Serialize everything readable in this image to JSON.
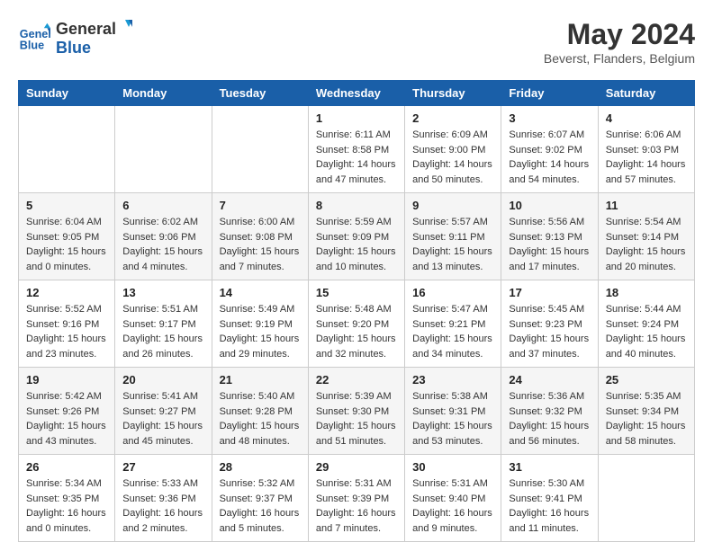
{
  "logo": {
    "line1": "General",
    "line2": "Blue"
  },
  "title": "May 2024",
  "location": "Beverst, Flanders, Belgium",
  "weekdays": [
    "Sunday",
    "Monday",
    "Tuesday",
    "Wednesday",
    "Thursday",
    "Friday",
    "Saturday"
  ],
  "weeks": [
    [
      {
        "day": "",
        "sunrise": "",
        "sunset": "",
        "daylight": ""
      },
      {
        "day": "",
        "sunrise": "",
        "sunset": "",
        "daylight": ""
      },
      {
        "day": "",
        "sunrise": "",
        "sunset": "",
        "daylight": ""
      },
      {
        "day": "1",
        "sunrise": "Sunrise: 6:11 AM",
        "sunset": "Sunset: 8:58 PM",
        "daylight": "Daylight: 14 hours and 47 minutes."
      },
      {
        "day": "2",
        "sunrise": "Sunrise: 6:09 AM",
        "sunset": "Sunset: 9:00 PM",
        "daylight": "Daylight: 14 hours and 50 minutes."
      },
      {
        "day": "3",
        "sunrise": "Sunrise: 6:07 AM",
        "sunset": "Sunset: 9:02 PM",
        "daylight": "Daylight: 14 hours and 54 minutes."
      },
      {
        "day": "4",
        "sunrise": "Sunrise: 6:06 AM",
        "sunset": "Sunset: 9:03 PM",
        "daylight": "Daylight: 14 hours and 57 minutes."
      }
    ],
    [
      {
        "day": "5",
        "sunrise": "Sunrise: 6:04 AM",
        "sunset": "Sunset: 9:05 PM",
        "daylight": "Daylight: 15 hours and 0 minutes."
      },
      {
        "day": "6",
        "sunrise": "Sunrise: 6:02 AM",
        "sunset": "Sunset: 9:06 PM",
        "daylight": "Daylight: 15 hours and 4 minutes."
      },
      {
        "day": "7",
        "sunrise": "Sunrise: 6:00 AM",
        "sunset": "Sunset: 9:08 PM",
        "daylight": "Daylight: 15 hours and 7 minutes."
      },
      {
        "day": "8",
        "sunrise": "Sunrise: 5:59 AM",
        "sunset": "Sunset: 9:09 PM",
        "daylight": "Daylight: 15 hours and 10 minutes."
      },
      {
        "day": "9",
        "sunrise": "Sunrise: 5:57 AM",
        "sunset": "Sunset: 9:11 PM",
        "daylight": "Daylight: 15 hours and 13 minutes."
      },
      {
        "day": "10",
        "sunrise": "Sunrise: 5:56 AM",
        "sunset": "Sunset: 9:13 PM",
        "daylight": "Daylight: 15 hours and 17 minutes."
      },
      {
        "day": "11",
        "sunrise": "Sunrise: 5:54 AM",
        "sunset": "Sunset: 9:14 PM",
        "daylight": "Daylight: 15 hours and 20 minutes."
      }
    ],
    [
      {
        "day": "12",
        "sunrise": "Sunrise: 5:52 AM",
        "sunset": "Sunset: 9:16 PM",
        "daylight": "Daylight: 15 hours and 23 minutes."
      },
      {
        "day": "13",
        "sunrise": "Sunrise: 5:51 AM",
        "sunset": "Sunset: 9:17 PM",
        "daylight": "Daylight: 15 hours and 26 minutes."
      },
      {
        "day": "14",
        "sunrise": "Sunrise: 5:49 AM",
        "sunset": "Sunset: 9:19 PM",
        "daylight": "Daylight: 15 hours and 29 minutes."
      },
      {
        "day": "15",
        "sunrise": "Sunrise: 5:48 AM",
        "sunset": "Sunset: 9:20 PM",
        "daylight": "Daylight: 15 hours and 32 minutes."
      },
      {
        "day": "16",
        "sunrise": "Sunrise: 5:47 AM",
        "sunset": "Sunset: 9:21 PM",
        "daylight": "Daylight: 15 hours and 34 minutes."
      },
      {
        "day": "17",
        "sunrise": "Sunrise: 5:45 AM",
        "sunset": "Sunset: 9:23 PM",
        "daylight": "Daylight: 15 hours and 37 minutes."
      },
      {
        "day": "18",
        "sunrise": "Sunrise: 5:44 AM",
        "sunset": "Sunset: 9:24 PM",
        "daylight": "Daylight: 15 hours and 40 minutes."
      }
    ],
    [
      {
        "day": "19",
        "sunrise": "Sunrise: 5:42 AM",
        "sunset": "Sunset: 9:26 PM",
        "daylight": "Daylight: 15 hours and 43 minutes."
      },
      {
        "day": "20",
        "sunrise": "Sunrise: 5:41 AM",
        "sunset": "Sunset: 9:27 PM",
        "daylight": "Daylight: 15 hours and 45 minutes."
      },
      {
        "day": "21",
        "sunrise": "Sunrise: 5:40 AM",
        "sunset": "Sunset: 9:28 PM",
        "daylight": "Daylight: 15 hours and 48 minutes."
      },
      {
        "day": "22",
        "sunrise": "Sunrise: 5:39 AM",
        "sunset": "Sunset: 9:30 PM",
        "daylight": "Daylight: 15 hours and 51 minutes."
      },
      {
        "day": "23",
        "sunrise": "Sunrise: 5:38 AM",
        "sunset": "Sunset: 9:31 PM",
        "daylight": "Daylight: 15 hours and 53 minutes."
      },
      {
        "day": "24",
        "sunrise": "Sunrise: 5:36 AM",
        "sunset": "Sunset: 9:32 PM",
        "daylight": "Daylight: 15 hours and 56 minutes."
      },
      {
        "day": "25",
        "sunrise": "Sunrise: 5:35 AM",
        "sunset": "Sunset: 9:34 PM",
        "daylight": "Daylight: 15 hours and 58 minutes."
      }
    ],
    [
      {
        "day": "26",
        "sunrise": "Sunrise: 5:34 AM",
        "sunset": "Sunset: 9:35 PM",
        "daylight": "Daylight: 16 hours and 0 minutes."
      },
      {
        "day": "27",
        "sunrise": "Sunrise: 5:33 AM",
        "sunset": "Sunset: 9:36 PM",
        "daylight": "Daylight: 16 hours and 2 minutes."
      },
      {
        "day": "28",
        "sunrise": "Sunrise: 5:32 AM",
        "sunset": "Sunset: 9:37 PM",
        "daylight": "Daylight: 16 hours and 5 minutes."
      },
      {
        "day": "29",
        "sunrise": "Sunrise: 5:31 AM",
        "sunset": "Sunset: 9:39 PM",
        "daylight": "Daylight: 16 hours and 7 minutes."
      },
      {
        "day": "30",
        "sunrise": "Sunrise: 5:31 AM",
        "sunset": "Sunset: 9:40 PM",
        "daylight": "Daylight: 16 hours and 9 minutes."
      },
      {
        "day": "31",
        "sunrise": "Sunrise: 5:30 AM",
        "sunset": "Sunset: 9:41 PM",
        "daylight": "Daylight: 16 hours and 11 minutes."
      },
      {
        "day": "",
        "sunrise": "",
        "sunset": "",
        "daylight": ""
      }
    ]
  ]
}
